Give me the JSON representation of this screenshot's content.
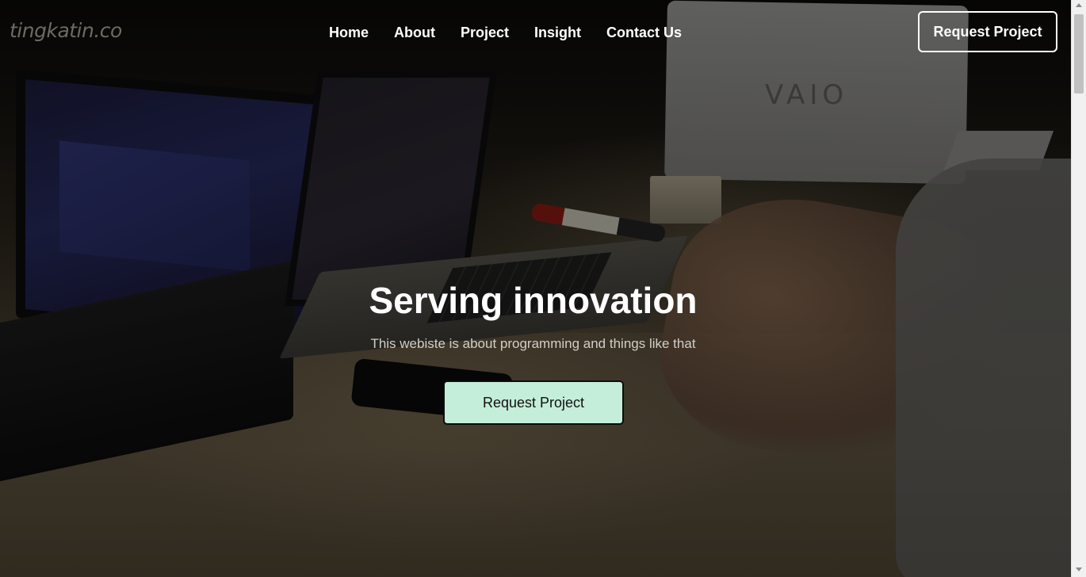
{
  "brand": {
    "logo_text": "tingkatin.co"
  },
  "nav": {
    "links": [
      "Home",
      "About",
      "Project",
      "Insight",
      "Contact Us"
    ],
    "cta_label": "Request Project"
  },
  "hero": {
    "title": "Serving innovation",
    "subtitle": "This webiste is about programming and things like that",
    "cta_label": "Request Project",
    "background_text": "VAIO"
  },
  "colors": {
    "cta_background": "#c4eed9",
    "nav_text": "#ffffff",
    "subtitle_text": "#d2cfc6"
  }
}
